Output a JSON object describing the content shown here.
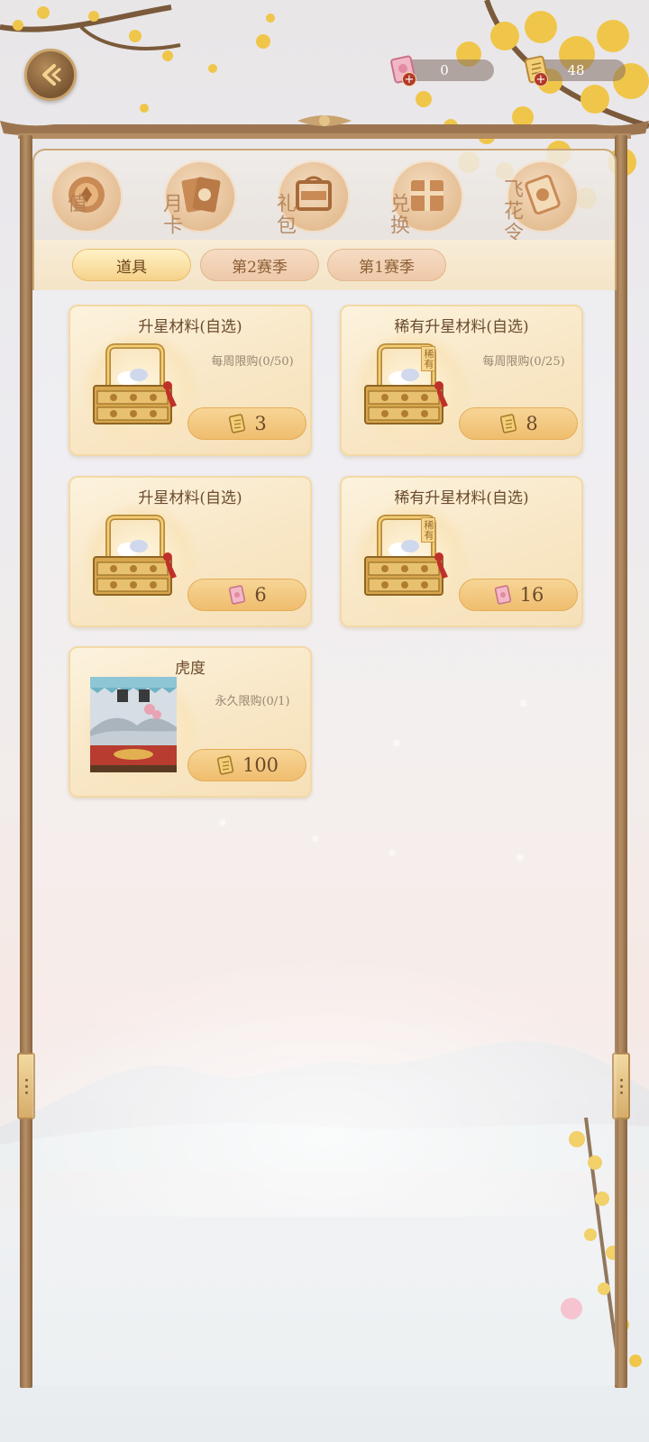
{
  "header": {
    "currencies": [
      {
        "icon": "pink-ticket-icon",
        "value": "0"
      },
      {
        "icon": "gold-scroll-icon",
        "value": "48"
      }
    ]
  },
  "categories": [
    {
      "icon": "coin-icon",
      "label": "值"
    },
    {
      "icon": "monthly-card-icon",
      "label": "月卡"
    },
    {
      "icon": "gift-pack-icon",
      "label": "礼包"
    },
    {
      "icon": "exchange-box-icon",
      "label": "兑换"
    },
    {
      "icon": "flower-scroll-icon",
      "label": "飞花令"
    }
  ],
  "tabs": [
    {
      "label": "道具",
      "active": true
    },
    {
      "label": "第2赛季",
      "active": false
    },
    {
      "label": "第1赛季",
      "active": false
    }
  ],
  "items": [
    {
      "title": "升星材料(自选)",
      "limit": "每周限购(0/50)",
      "price": "3",
      "currency_icon": "gold-scroll-icon",
      "image": "treasure-basket"
    },
    {
      "title": "稀有升星材料(自选)",
      "limit": "每周限购(0/25)",
      "price": "8",
      "currency_icon": "gold-scroll-icon",
      "image": "rare-treasure-basket",
      "tag": "稀有"
    },
    {
      "title": "升星材料(自选)",
      "limit": "",
      "price": "6",
      "currency_icon": "pink-ticket-icon",
      "image": "treasure-basket"
    },
    {
      "title": "稀有升星材料(自选)",
      "limit": "",
      "price": "16",
      "currency_icon": "pink-ticket-icon",
      "image": "rare-treasure-basket",
      "tag": "稀有"
    },
    {
      "title": "虎度",
      "limit": "永久限购(0/1)",
      "price": "100",
      "currency_icon": "gold-scroll-icon",
      "image": "stage-scene"
    }
  ],
  "colors": {
    "frame": "#9c7550",
    "card": "#f8e6c4",
    "price_button": "#efbd6e",
    "active_tab": "#f6d28a"
  }
}
